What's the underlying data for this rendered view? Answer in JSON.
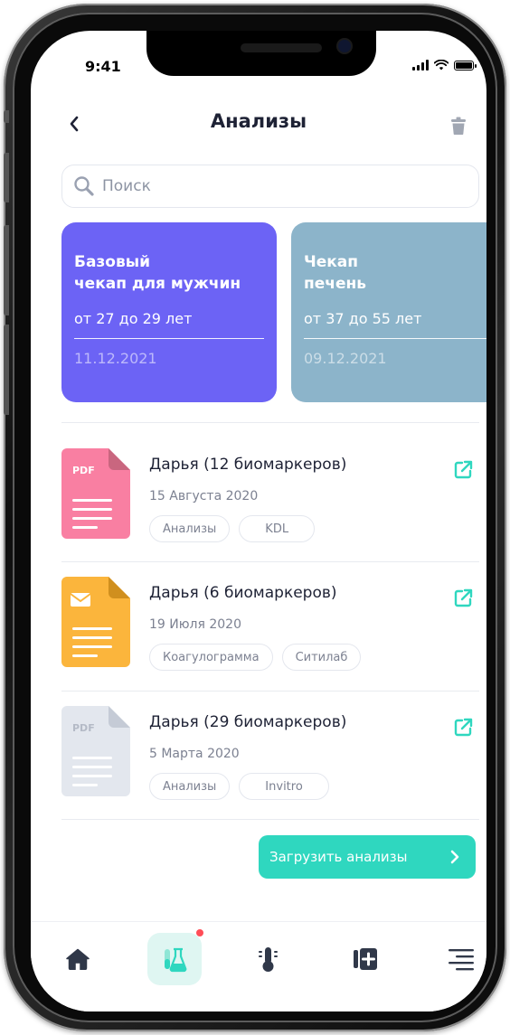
{
  "status_bar": {
    "time": "9:41"
  },
  "header": {
    "title": "Анализы"
  },
  "search": {
    "placeholder": "Поиск"
  },
  "cards": [
    {
      "title": "Базовый\nчекап для мужчин",
      "age": "от 27 до 29 лет",
      "date": "11.12.2021",
      "color": "#6c63f5"
    },
    {
      "title": "Чекап\nпечень",
      "age": "от 37 до 55 лет",
      "date": "09.12.2021",
      "color": "#8cb4ca"
    }
  ],
  "documents": [
    {
      "title": "Дарья (12 биомаркеров)",
      "date": "15 Августа 2020",
      "tags": [
        "Анализы",
        "KDL"
      ],
      "icon": "pdf-file-icon",
      "color": "#f97fa2",
      "label": "PDF"
    },
    {
      "title": "Дарья (6 биомаркеров)",
      "date": "19 Июля 2020",
      "tags": [
        "Коагулограмма",
        "Ситилаб"
      ],
      "icon": "mail-file-icon",
      "color": "#fbb53c"
    },
    {
      "title": "Дарья (29 биомаркеров)",
      "date": "5 Марта 2020",
      "tags": [
        "Анализы",
        "Invitro"
      ],
      "icon": "pdf-file-icon",
      "color": "#e3e7ee",
      "label": "PDF"
    }
  ],
  "upload_button": {
    "label": "Загрузить анализы"
  },
  "tabbar": {
    "items": [
      {
        "icon": "home-icon"
      },
      {
        "icon": "flask-icon",
        "active": true,
        "badge": true
      },
      {
        "icon": "thermometer-icon"
      },
      {
        "icon": "medical-card-icon"
      },
      {
        "icon": "menu-icon"
      }
    ]
  },
  "colors": {
    "accent": "#2fd7bf",
    "text": "#1e2235",
    "muted": "#7c8191",
    "badge": "#ff4d57"
  }
}
